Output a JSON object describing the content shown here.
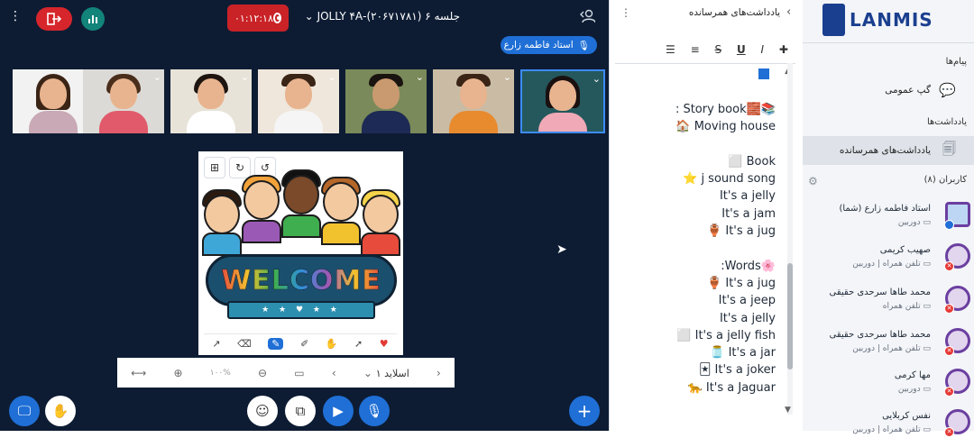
{
  "conference": {
    "leave_icon": "exit-icon",
    "stats_icon": "bar-chart-icon",
    "recording_time": "۰۱:۱۲:۱۸",
    "session_title": "جلسه ۶ (۲۰۶۷۱۷۸۱)-JOLLY ۴A",
    "presenter_name": "استاد فاطمه زارع",
    "colors": {
      "background": "#0d1c33",
      "leave": "#d6262b",
      "stats": "#12847a",
      "record": "#c92327",
      "accent": "#1f6fd6"
    }
  },
  "whiteboard": {
    "welcome_text": "WELCOME",
    "slide_label": "اسلاید ۱",
    "zoom_label": "۱۰۰%",
    "top_tools": [
      "undo-icon",
      "redo-icon",
      "multi-user-icon"
    ],
    "draw_tools": [
      "arrow-icon",
      "eraser-icon",
      "pen-icon",
      "highlighter-icon",
      "hand-icon",
      "pointer-icon",
      "color-icon"
    ]
  },
  "controls": {
    "buttons": [
      "add-icon",
      "microphone-icon",
      "camera-icon",
      "screen-share-icon",
      "emoji-icon",
      "raise-hand-icon",
      "presentation-icon"
    ]
  },
  "notes": {
    "title": "یادداشت‌های همرسانده",
    "format_tools": [
      "bold",
      "italic",
      "underline",
      "strikethrough",
      "ordered-list",
      "unordered-list"
    ],
    "lines": [
      {
        "text": "📚🧱Story book :"
      },
      {
        "text": "Moving house 🏠"
      },
      {
        "text": ""
      },
      {
        "text": "Book ⬜"
      },
      {
        "text": "j sound song ⭐"
      },
      {
        "text": "It's a jelly"
      },
      {
        "text": "It's a jam"
      },
      {
        "text": "It's a jug 🏺"
      },
      {
        "text": ""
      },
      {
        "text": "🌸Words:"
      },
      {
        "text": "It's a jug 🏺"
      },
      {
        "text": "It's a jeep"
      },
      {
        "text": "It's a jelly"
      },
      {
        "text": "It's a jelly fish ⬜"
      },
      {
        "text": "It's a jar 🫙"
      },
      {
        "text": "It's a joker 🃏"
      },
      {
        "text": "It's a Jaguar 🐆"
      }
    ]
  },
  "sidebar": {
    "brand": "LANMIS",
    "messages_header": "پیام‌ها",
    "public_chat": "گپ عمومی",
    "notes_header": "یادداشت‌ها",
    "shared_notes": "یادداشت‌های همرسانده",
    "users_header": "کاربران (۸)",
    "users": [
      {
        "name": "استاد فاطمه زارع (شما)",
        "device": "دوربین"
      },
      {
        "name": "صهیب کریمی",
        "device": "تلفن همراه | دوربین"
      },
      {
        "name": "محمد طاها سرحدی حقیقی",
        "device": "تلفن همراه"
      },
      {
        "name": "محمد طاها سرحدی حقیقی",
        "device": "تلفن همراه | دوربین"
      },
      {
        "name": "مها کرمی",
        "device": "دوربین"
      },
      {
        "name": "نفس کربلایی",
        "device": "تلفن همراه | دوربین"
      }
    ]
  }
}
